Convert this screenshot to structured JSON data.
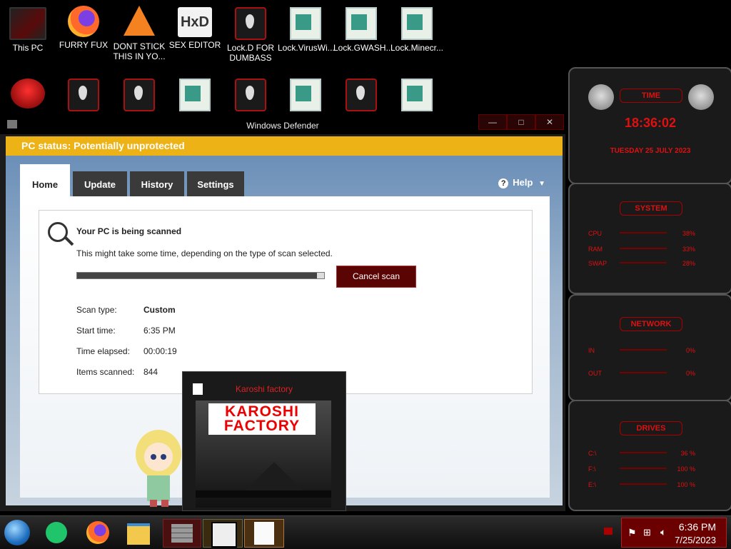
{
  "desktop": {
    "row1": [
      {
        "label": "This PC",
        "icon": "this-pc-icon"
      },
      {
        "label": "FURRY FUX",
        "icon": "firefox-icon"
      },
      {
        "label": "DONT STICK THIS IN YO...",
        "icon": "vlc-icon"
      },
      {
        "label": "SEX EDITOR",
        "icon": "hxd-icon"
      },
      {
        "label": "Lock.D FOR DUMBASS",
        "icon": "alien-shortcut-icon"
      },
      {
        "label": "Lock.VirusWi...",
        "icon": "file-icon"
      },
      {
        "label": "Lock.GWASH...",
        "icon": "file-icon"
      },
      {
        "label": "Lock.Minecr...",
        "icon": "file-icon"
      }
    ]
  },
  "defender": {
    "title": "Windows Defender",
    "window_buttons": [
      "—",
      "□",
      "✕"
    ],
    "status": "PC status: Potentially unprotected",
    "tabs": [
      "Home",
      "Update",
      "History",
      "Settings"
    ],
    "help": "Help",
    "scan_title": "Your PC is being scanned",
    "scan_sub": "This might take some time, depending on the type of scan selected.",
    "progress": 0.97,
    "cancel": "Cancel scan",
    "info": [
      {
        "label": "Scan type:",
        "value": "Custom"
      },
      {
        "label": "Start time:",
        "value": "6:35 PM"
      },
      {
        "label": "Time elapsed:",
        "value": "00:00:19"
      },
      {
        "label": "Items scanned:",
        "value": "844"
      }
    ]
  },
  "popup": {
    "title": "Karoshi factory",
    "logo_line1": "KAROSHI",
    "logo_line2": "FACTORY"
  },
  "widgets": {
    "time": {
      "title": "TIME",
      "clock": "18:36:02",
      "date": "TUESDAY 25 JULY 2023"
    },
    "system": {
      "title": "SYSTEM",
      "rows": [
        {
          "label": "CPU",
          "value": "38%"
        },
        {
          "label": "RAM",
          "value": "33%"
        },
        {
          "label": "SWAP",
          "value": "28%"
        }
      ]
    },
    "network": {
      "title": "NETWORK",
      "rows": [
        {
          "label": "IN",
          "value": "0%"
        },
        {
          "label": "OUT",
          "value": "0%"
        }
      ]
    },
    "drives": {
      "title": "DRIVES",
      "rows": [
        {
          "label": "C:\\",
          "value": "36 %"
        },
        {
          "label": "F:\\",
          "value": "100 %"
        },
        {
          "label": "E:\\",
          "value": "100 %"
        }
      ]
    }
  },
  "taskbar": {
    "time": "6:36 PM",
    "date": "7/25/2023"
  },
  "colors": {
    "accent_red": "#e01010",
    "status_yellow": "#ecb216",
    "cancel_red": "#5a0404"
  }
}
